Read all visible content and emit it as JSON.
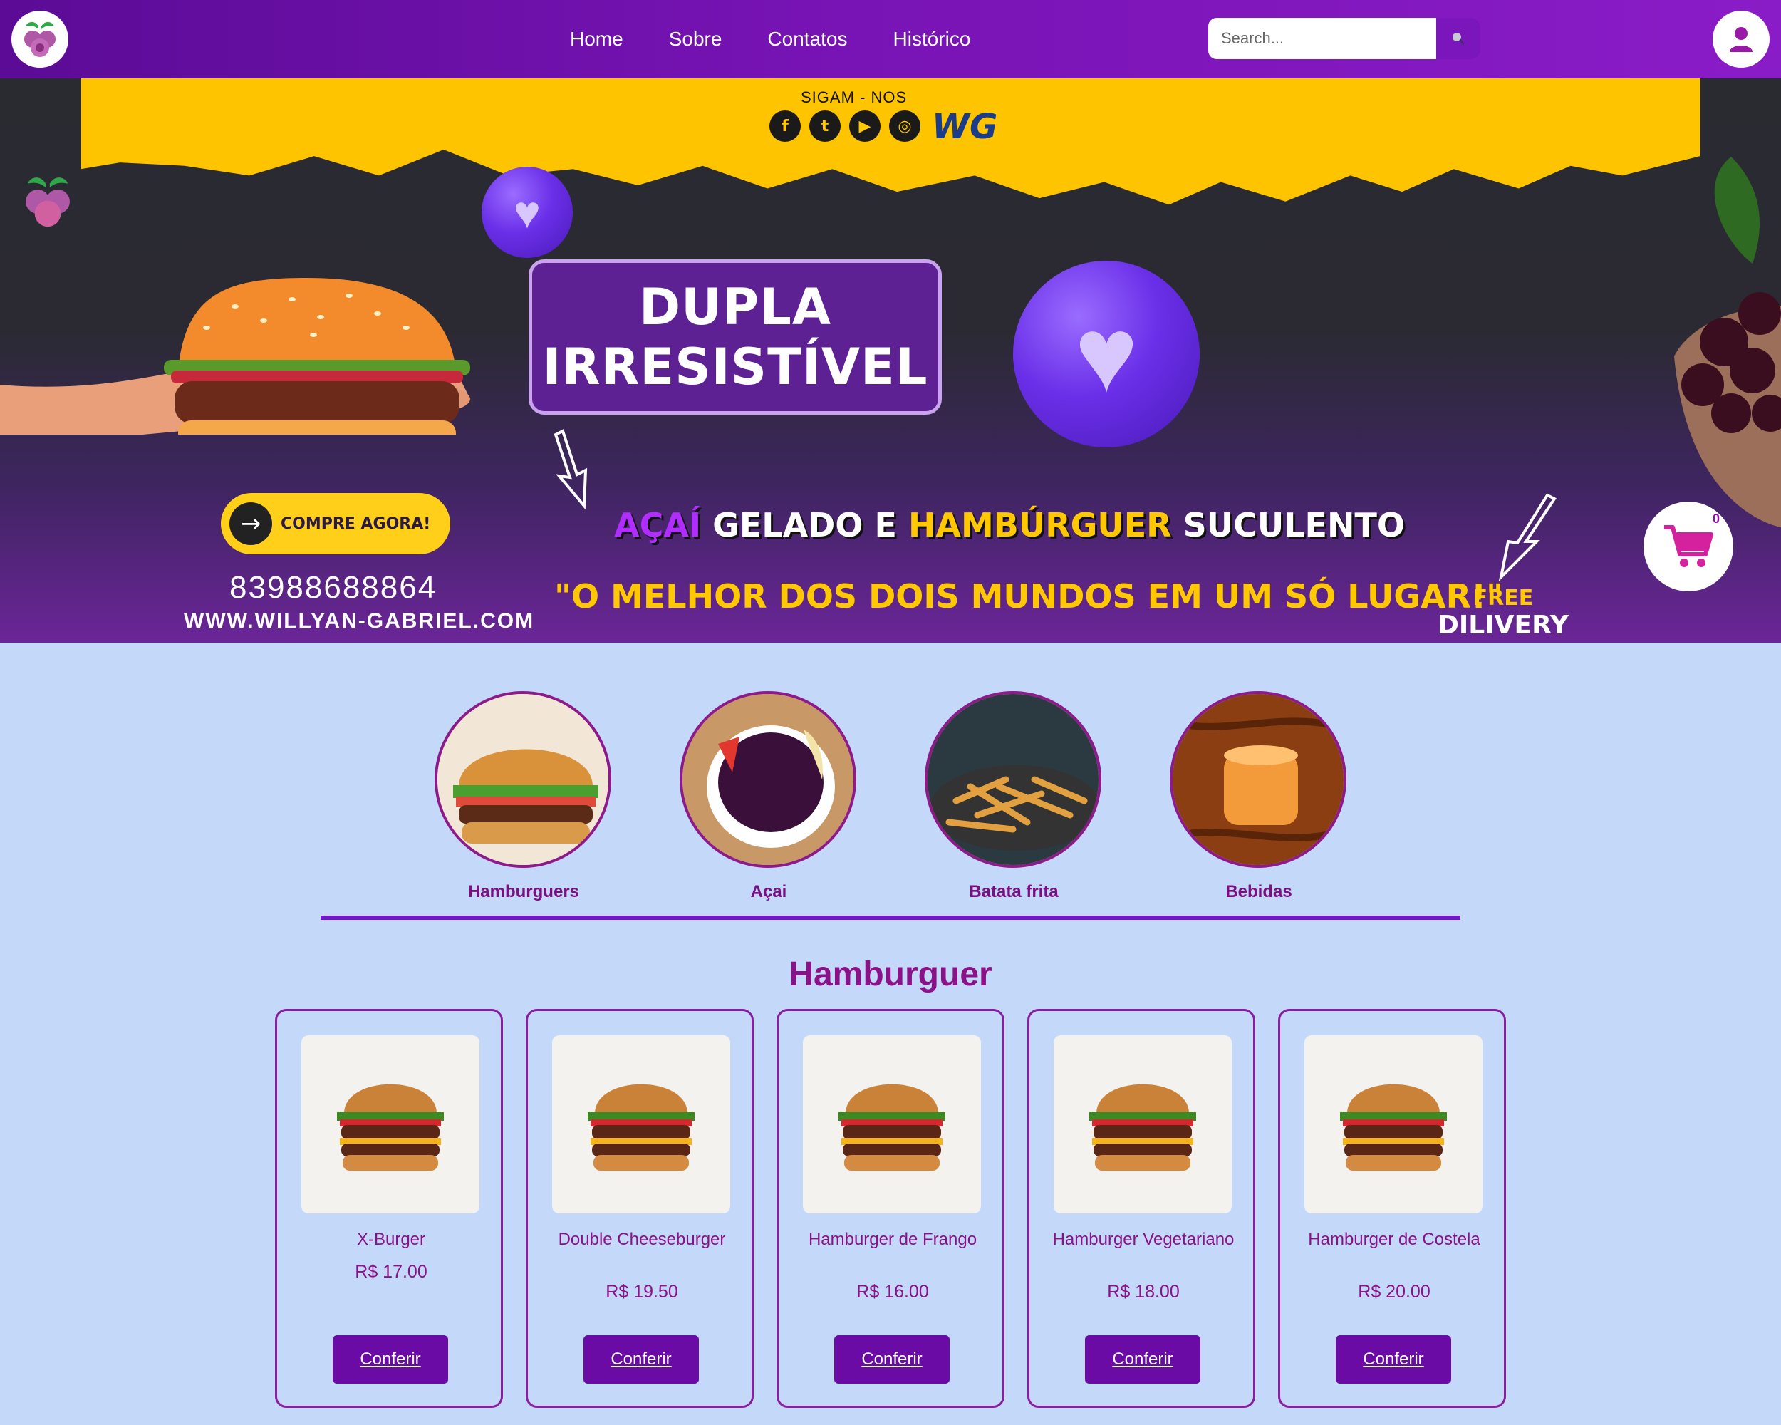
{
  "nav": {
    "logo_icon": "acai-berry-logo-icon",
    "links": [
      "Home",
      "Sobre",
      "Contatos",
      "Histórico"
    ],
    "search_placeholder": "Search...",
    "search_icon": "search-icon",
    "user_icon": "user-icon"
  },
  "banner": {
    "follow_label": "SIGAM - NOS",
    "socials": [
      "facebook-icon",
      "twitter-icon",
      "youtube-icon",
      "instagram-icon"
    ],
    "brand_mark": "WG",
    "title_line1": "DUPLA",
    "title_line2": "IRRESISTÍVEL",
    "tag_acai": "AÇAÍ",
    "tag_gelado": "GELADO E",
    "tag_hamburguer": "HAMBÚRGUER",
    "tag_suculento": "SUCULENTO",
    "quote": "\"O MELHOR DOS DOIS MUNDOS EM UM SÓ LUGAR!\"",
    "buy_label": "COMPRE AGORA!",
    "phone": "83988688864",
    "website": "WWW.WILLYAN-GABRIEL.COM",
    "free_label": "FREE",
    "delivery_label": "DILIVERY",
    "cart_count": "0"
  },
  "categories": [
    {
      "label": "Hamburguers"
    },
    {
      "label": "Açai"
    },
    {
      "label": "Batata frita"
    },
    {
      "label": "Bebidas"
    }
  ],
  "section_title": "Hamburguer",
  "products": [
    {
      "name": "X-Burger",
      "price": "R$ 17.00",
      "button": "Conferir"
    },
    {
      "name": "Double Cheeseburger",
      "price": "R$ 19.50",
      "button": "Conferir"
    },
    {
      "name": "Hamburger de Frango",
      "price": "R$ 16.00",
      "button": "Conferir"
    },
    {
      "name": "Hamburger Vegetariano",
      "price": "R$ 18.00",
      "button": "Conferir"
    },
    {
      "name": "Hamburger de Costela",
      "price": "R$ 20.00",
      "button": "Conferir"
    }
  ],
  "colors": {
    "nav": "#7713b4",
    "accent": "#ffc800",
    "brand": "#8b1188",
    "button": "#6a0ba6",
    "page": "#c4d8fa"
  }
}
